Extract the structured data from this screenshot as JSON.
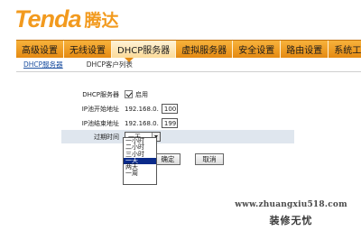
{
  "brand": {
    "name_latin": "Tenda",
    "name_cn": "腾达",
    "accent": "#f29a1e"
  },
  "nav": {
    "items": [
      "高级设置",
      "无线设置",
      "DHCP服务器",
      "虚拟服务器",
      "安全设置",
      "路由设置",
      "系统工具"
    ],
    "active_index": 2
  },
  "subnav": {
    "items": [
      "DHCP服务器",
      "DHCP客户列表"
    ],
    "active_index": 0
  },
  "form": {
    "dhcp": {
      "label": "DHCP服务器",
      "checkbox_label": "启用",
      "checked": true
    },
    "ip_start": {
      "label": "IP池开始地址",
      "prefix": "192.168.0.",
      "value": "100"
    },
    "ip_end": {
      "label": "IP池结束地址",
      "prefix": "192.168.0.",
      "value": "199"
    },
    "lease": {
      "label": "过期时间",
      "selected": "一天",
      "options": [
        "一小时",
        "二小时",
        "三小时",
        "一天",
        "两天",
        "一周"
      ],
      "highlighted_index": 3
    }
  },
  "buttons": {
    "ok": "确定",
    "cancel": "取消"
  },
  "watermark": {
    "url": "www.zhuangxiu518.com",
    "text": "装修无忧"
  }
}
